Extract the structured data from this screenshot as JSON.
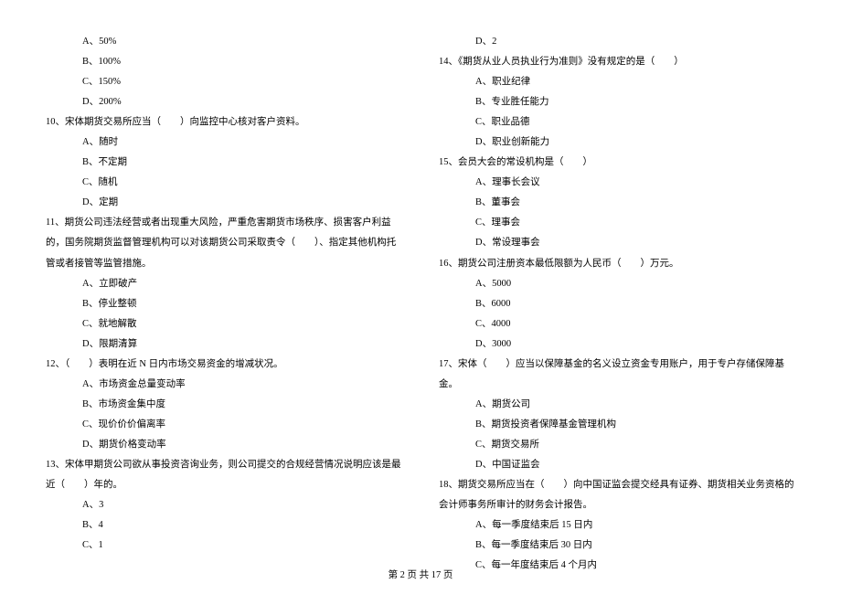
{
  "left": [
    {
      "cls": "opt",
      "t": "A、50%"
    },
    {
      "cls": "opt",
      "t": "B、100%"
    },
    {
      "cls": "opt",
      "t": "C、150%"
    },
    {
      "cls": "opt",
      "t": "D、200%"
    },
    {
      "cls": "q",
      "t": "10、宋体期货交易所应当（　　）向监控中心核对客户资料。"
    },
    {
      "cls": "opt",
      "t": "A、随时"
    },
    {
      "cls": "opt",
      "t": "B、不定期"
    },
    {
      "cls": "opt",
      "t": "C、随机"
    },
    {
      "cls": "opt",
      "t": "D、定期"
    },
    {
      "cls": "q",
      "t": "11、期货公司违法经营或者出现重大风险，严重危害期货市场秩序、损害客户利益的，国务院期货监督管理机构可以对该期货公司采取责令（　　）、指定其他机构托管或者接管等监管措施。"
    },
    {
      "cls": "opt",
      "t": "A、立即破产"
    },
    {
      "cls": "opt",
      "t": "B、停业整顿"
    },
    {
      "cls": "opt",
      "t": "C、就地解散"
    },
    {
      "cls": "opt",
      "t": "D、限期清算"
    },
    {
      "cls": "q",
      "t": "12、（　　）表明在近 N 日内市场交易资金的增减状况。"
    },
    {
      "cls": "opt",
      "t": "A、市场资金总量变动率"
    },
    {
      "cls": "opt",
      "t": "B、市场资金集中度"
    },
    {
      "cls": "opt",
      "t": "C、现价价价偏离率"
    },
    {
      "cls": "opt",
      "t": "D、期货价格变动率"
    },
    {
      "cls": "q",
      "t": "13、宋体甲期货公司欲从事投资咨询业务，则公司提交的合规经营情况说明应该是最近（　　）年的。"
    },
    {
      "cls": "opt",
      "t": "A、3"
    },
    {
      "cls": "opt",
      "t": "B、4"
    },
    {
      "cls": "opt",
      "t": "C、1"
    }
  ],
  "right": [
    {
      "cls": "opt",
      "t": "D、2"
    },
    {
      "cls": "q",
      "t": "14、《期货从业人员执业行为准则》没有规定的是（　　）"
    },
    {
      "cls": "opt",
      "t": "A、职业纪律"
    },
    {
      "cls": "opt",
      "t": "B、专业胜任能力"
    },
    {
      "cls": "opt",
      "t": "C、职业品德"
    },
    {
      "cls": "opt",
      "t": "D、职业创新能力"
    },
    {
      "cls": "q",
      "t": "15、会员大会的常设机构是（　　）"
    },
    {
      "cls": "opt",
      "t": "A、理事长会议"
    },
    {
      "cls": "opt",
      "t": "B、董事会"
    },
    {
      "cls": "opt",
      "t": "C、理事会"
    },
    {
      "cls": "opt",
      "t": "D、常设理事会"
    },
    {
      "cls": "q",
      "t": "16、期货公司注册资本最低限额为人民币（　　）万元。"
    },
    {
      "cls": "opt",
      "t": "A、5000"
    },
    {
      "cls": "opt",
      "t": "B、6000"
    },
    {
      "cls": "opt",
      "t": "C、4000"
    },
    {
      "cls": "opt",
      "t": "D、3000"
    },
    {
      "cls": "q",
      "t": "17、宋体（　　）应当以保障基金的名义设立资金专用账户，用于专户存储保障基金。"
    },
    {
      "cls": "opt",
      "t": "A、期货公司"
    },
    {
      "cls": "opt",
      "t": "B、期货投资者保障基金管理机构"
    },
    {
      "cls": "opt",
      "t": "C、期货交易所"
    },
    {
      "cls": "opt",
      "t": "D、中国证监会"
    },
    {
      "cls": "q",
      "t": "18、期货交易所应当在（　　）向中国证监会提交经具有证券、期货相关业务资格的会计师事务所审计的财务会计报告。"
    },
    {
      "cls": "opt",
      "t": "A、每一季度结束后 15 日内"
    },
    {
      "cls": "opt",
      "t": "B、每一季度结束后 30 日内"
    },
    {
      "cls": "opt",
      "t": "C、每一年度结束后 4 个月内"
    }
  ],
  "footer": "第 2 页 共 17 页"
}
